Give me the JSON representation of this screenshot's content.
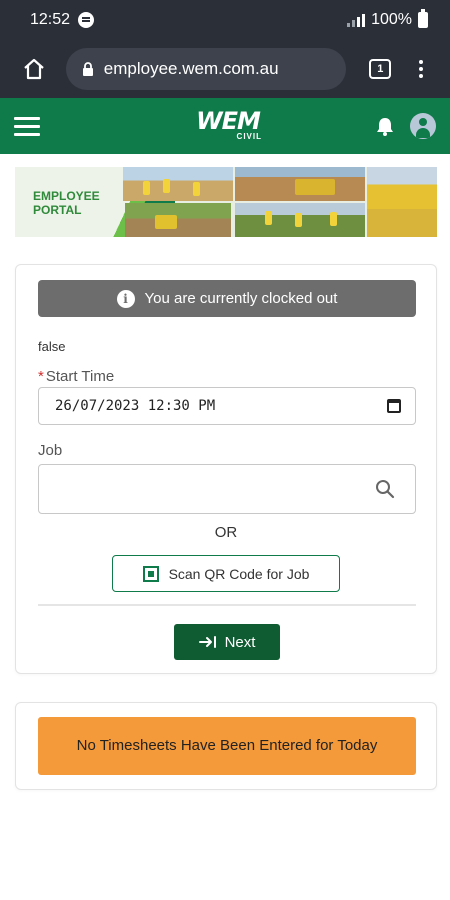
{
  "status_bar": {
    "time": "12:52",
    "battery": "100%"
  },
  "browser": {
    "url": "employee.wem.com.au",
    "tab_count": "1"
  },
  "app_header": {
    "logo_main": "WEM",
    "logo_sub": "CIVIL"
  },
  "banner": {
    "title_line1": "EMPLOYEE",
    "title_line2": "PORTAL"
  },
  "clock_in": {
    "status_text": "You are currently clocked out",
    "debug_text": "false",
    "start_time_label": "Start Time",
    "start_time_value": "26/07/2023 12:30 PM",
    "job_label": "Job",
    "job_value": "",
    "or_text": "OR",
    "scan_qr_label": "Scan QR Code for Job",
    "next_label": "Next"
  },
  "timesheets": {
    "empty_message": "No Timesheets Have Been Entered for Today"
  },
  "colors": {
    "brand_green": "#0f7a4a",
    "next_button": "#0f5b32",
    "status_grey": "#6d6d6d",
    "warning_orange": "#f49a3a"
  }
}
